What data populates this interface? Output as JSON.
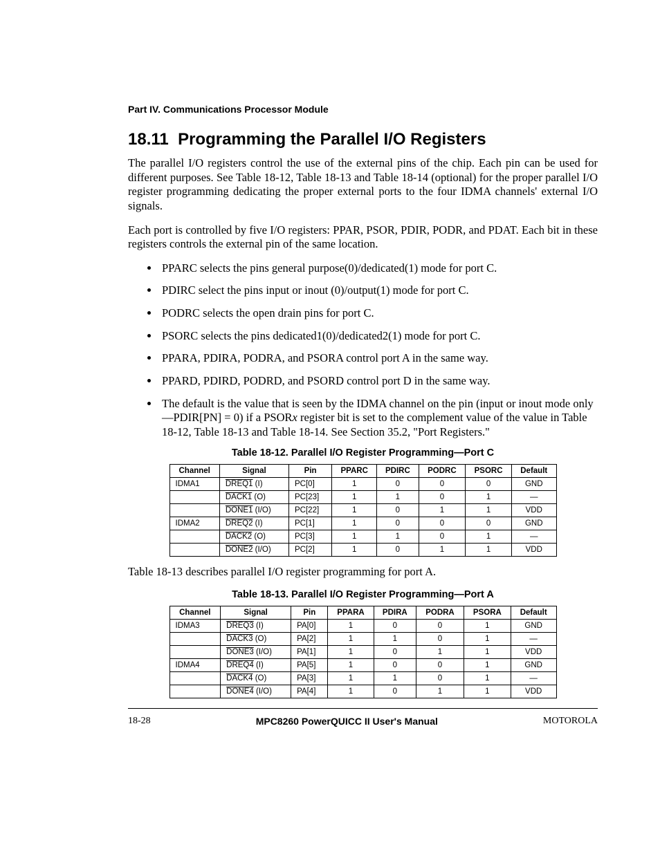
{
  "partHeader": "Part IV.  Communications Processor Module",
  "section": {
    "number": "18.11",
    "title": "Programming the Parallel I/O Registers"
  },
  "paras": {
    "p1": "The parallel I/O registers control the use of the external pins of the chip. Each pin can be used for different purposes. See Table 18-12, Table 18-13 and Table 18-14 (optional) for the proper parallel I/O register programming dedicating the proper external ports to the four IDMA channels' external I/O signals.",
    "p2": "Each port is controlled by five I/O registers: PPAR, PSOR, PDIR, PODR, and PDAT. Each bit in these registers controls the external pin of the same location.",
    "p3": "Table 18-13 describes parallel I/O register programming for port A."
  },
  "bullets": {
    "b1": "PPARC selects the pins general purpose(0)/dedicated(1) mode for port C.",
    "b2": "PDIRC select the pins input or inout (0)/output(1) mode for port C.",
    "b3": "PODRC selects the open drain pins for port C.",
    "b4": "PSORC selects the pins dedicated1(0)/dedicated2(1) mode for port C.",
    "b5": "PPARA, PDIRA, PODRA, and PSORA control port A in the same way.",
    "b6": "PPARD, PDIRD, PODRD, and PSORD control port D in the same way.",
    "b7a": "The default is the value that is seen by the IDMA channel on the pin (input or inout mode only—PDIR[PN] = 0) if a PSOR",
    "b7b": "x",
    "b7c": " register bit is set to the complement value of the value in Table 18-12, Table 18-13 and Table 18-14. See Section 35.2, \"Port Registers.\""
  },
  "table12": {
    "caption": "Table 18-12. Parallel I/O Register Programming—Port C",
    "heads": [
      "Channel",
      "Signal",
      "Pin",
      "PPARC",
      "PDIRC",
      "PODRC",
      "PSORC",
      "Default"
    ],
    "rows": [
      {
        "ch": "IDMA1",
        "sigOver": "DREQ1",
        "sigSuf": " (I)",
        "pin": "PC[0]",
        "c4": "1",
        "c5": "0",
        "c6": "0",
        "c7": "0",
        "def": "GND"
      },
      {
        "ch": "",
        "sigOver": "DACK1",
        "sigSuf": " (O)",
        "pin": "PC[23]",
        "c4": "1",
        "c5": "1",
        "c6": "0",
        "c7": "1",
        "def": "—"
      },
      {
        "ch": "",
        "sigOver": "DONE1",
        "sigSuf": " (I/O)",
        "pin": "PC[22]",
        "c4": "1",
        "c5": "0",
        "c6": "1",
        "c7": "1",
        "def": "VDD"
      },
      {
        "ch": "IDMA2",
        "sigOver": "DREQ2",
        "sigSuf": " (I)",
        "pin": "PC[1]",
        "c4": "1",
        "c5": "0",
        "c6": "0",
        "c7": "0",
        "def": "GND"
      },
      {
        "ch": "",
        "sigOver": "DACK2",
        "sigSuf": " (O)",
        "pin": "PC[3]",
        "c4": "1",
        "c5": "1",
        "c6": "0",
        "c7": "1",
        "def": "—"
      },
      {
        "ch": "",
        "sigOver": "DONE2",
        "sigSuf": " (I/O)",
        "pin": "PC[2]",
        "c4": "1",
        "c5": "0",
        "c6": "1",
        "c7": "1",
        "def": "VDD"
      }
    ]
  },
  "table13": {
    "caption": "Table 18-13. Parallel I/O Register Programming—Port A",
    "heads": [
      "Channel",
      "Signal",
      "Pin",
      "PPARA",
      "PDIRA",
      "PODRA",
      "PSORA",
      "Default"
    ],
    "rows": [
      {
        "ch": "IDMA3",
        "sigOver": "DREQ3",
        "sigSuf": " (I)",
        "pin": "PA[0]",
        "c4": "1",
        "c5": "0",
        "c6": "0",
        "c7": "1",
        "def": "GND"
      },
      {
        "ch": "",
        "sigOver": "DACK3",
        "sigSuf": " (O)",
        "pin": "PA[2]",
        "c4": "1",
        "c5": "1",
        "c6": "0",
        "c7": "1",
        "def": "—"
      },
      {
        "ch": "",
        "sigOver": "DONE3",
        "sigSuf": " (I/O)",
        "pin": "PA[1]",
        "c4": "1",
        "c5": "0",
        "c6": "1",
        "c7": "1",
        "def": "VDD"
      },
      {
        "ch": "IDMA4",
        "sigOver": "DREQ4",
        "sigSuf": " (I)",
        "pin": "PA[5]",
        "c4": "1",
        "c5": "0",
        "c6": "0",
        "c7": "1",
        "def": "GND"
      },
      {
        "ch": "",
        "sigOver": "DACK4",
        "sigSuf": " (O)",
        "pin": "PA[3]",
        "c4": "1",
        "c5": "1",
        "c6": "0",
        "c7": "1",
        "def": "—"
      },
      {
        "ch": "",
        "sigOver": "DONE4",
        "sigSuf": " (I/O)",
        "pin": "PA[4]",
        "c4": "1",
        "c5": "0",
        "c6": "1",
        "c7": "1",
        "def": "VDD"
      }
    ]
  },
  "footer": {
    "left": "18-28",
    "center": "MPC8260 PowerQUICC II User's Manual",
    "right": "MOTOROLA"
  }
}
